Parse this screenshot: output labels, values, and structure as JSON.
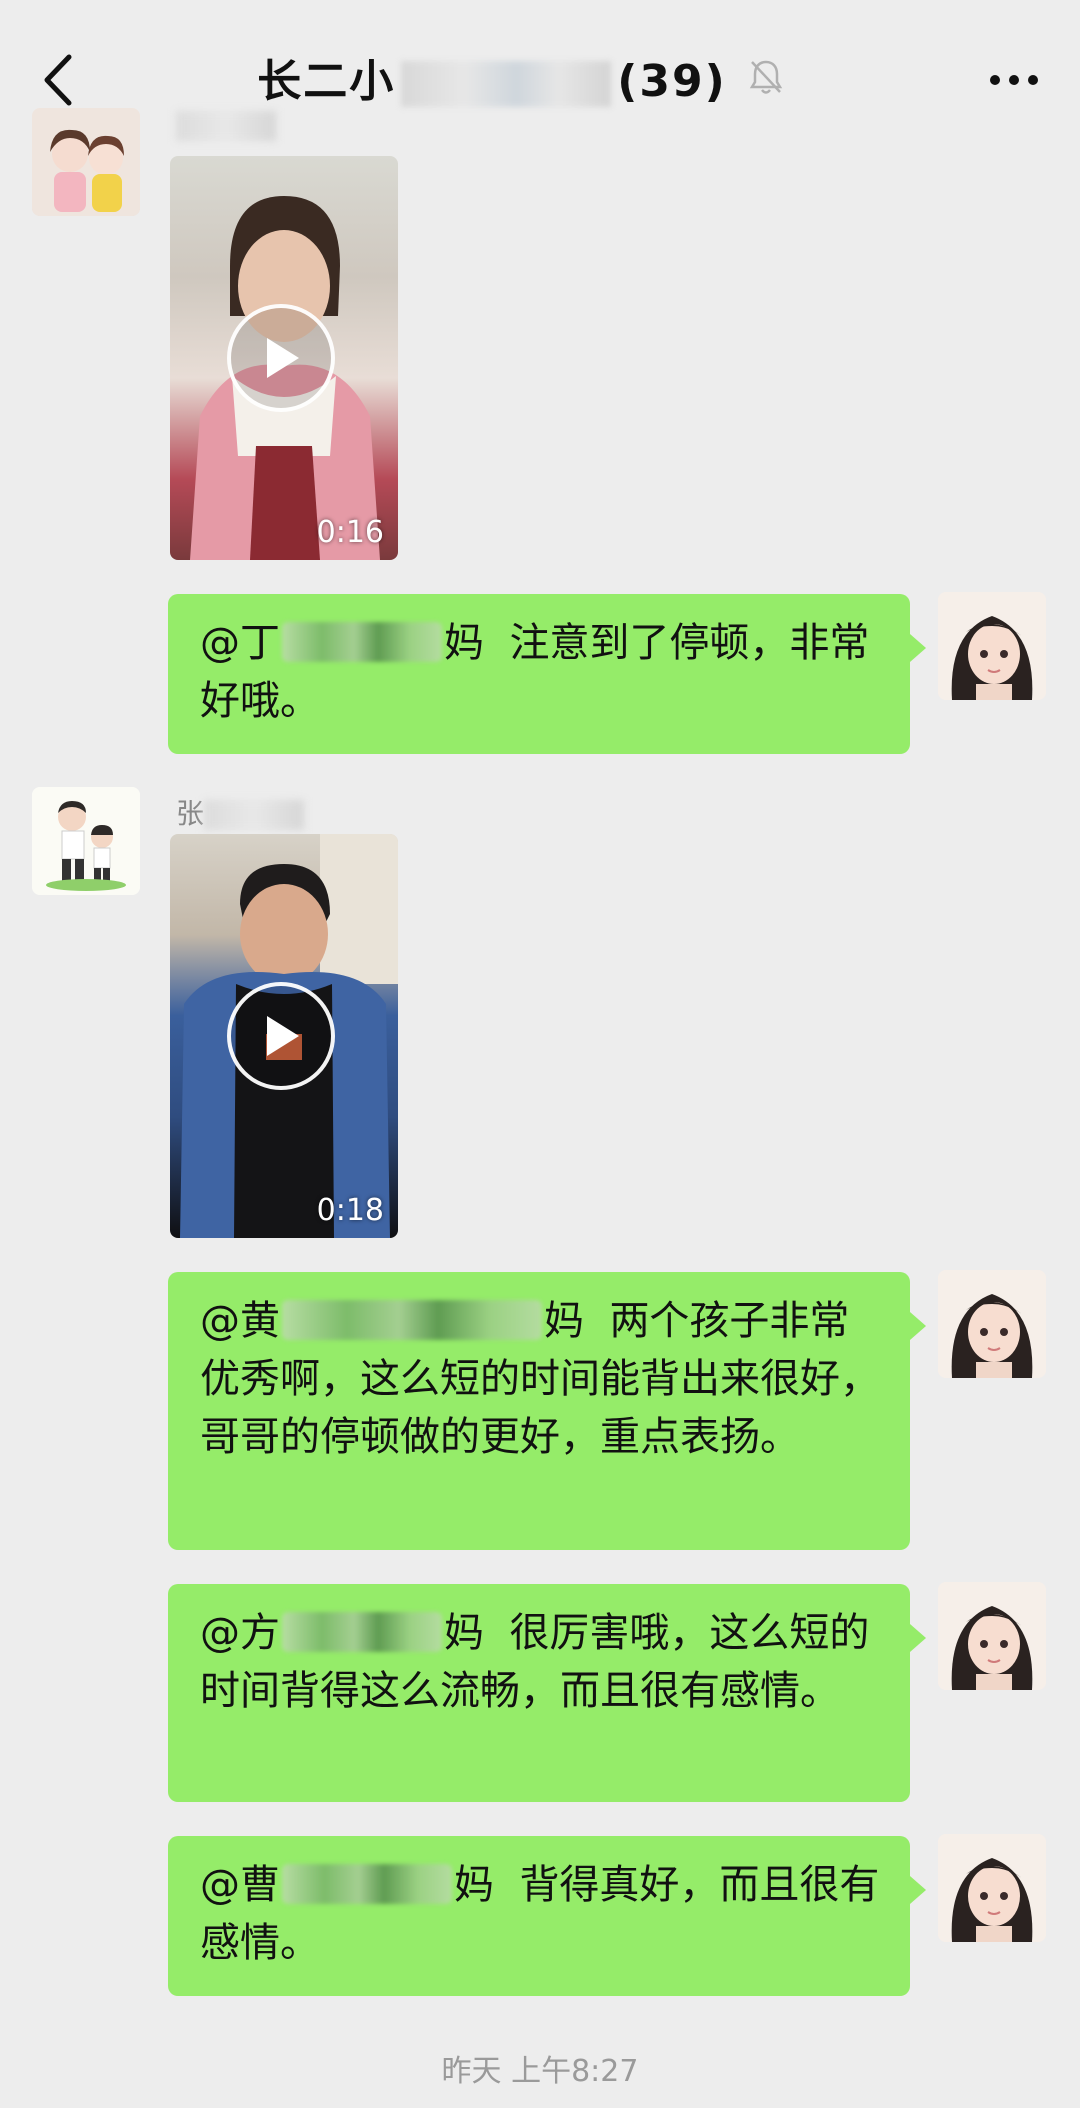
{
  "header": {
    "title_start": "长二小",
    "title_end": "(39)",
    "back_icon": "chevron-left-icon",
    "mute_icon": "bell-off-icon",
    "more_icon": "ellipsis-icon"
  },
  "messages": [
    {
      "type": "video",
      "sender_visible": "",
      "duration": "0:16"
    },
    {
      "type": "text",
      "mention_start": "@丁",
      "mention_end": "妈",
      "text": "注意到了停顿，非常好哦。"
    },
    {
      "type": "video",
      "sender_visible": "张",
      "duration": "0:18"
    },
    {
      "type": "text",
      "mention_start": "@黄",
      "mention_end": "妈",
      "text": "两个孩子非常优秀啊，这么短的时间能背出来很好，哥哥的停顿做的更好，重点表扬。"
    },
    {
      "type": "text",
      "mention_start": "@方",
      "mention_end": "妈",
      "text": "很厉害哦，这么短的时间背得这么流畅，而且很有感情。"
    },
    {
      "type": "text",
      "mention_start": "@曹",
      "mention_end": "妈",
      "text": "背得真好，而且很有感情。"
    }
  ],
  "footer_time": "昨天 上午8:27",
  "colors": {
    "bubble": "#95ec69",
    "background": "#ededed"
  }
}
